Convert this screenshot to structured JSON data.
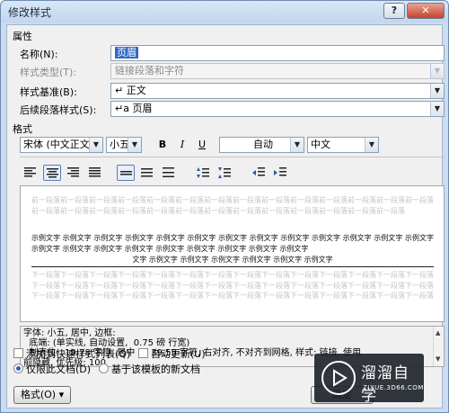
{
  "window": {
    "title": "修改样式",
    "help_label": "?",
    "close_label": "✕"
  },
  "properties": {
    "section_label": "属性",
    "name": {
      "label": "名称(N):",
      "value": "页眉"
    },
    "style_type": {
      "label": "样式类型(T):",
      "value": "链接段落和字符"
    },
    "based_on": {
      "label": "样式基准(B):",
      "value": "↵ 正文"
    },
    "next_style": {
      "label": "后续段落样式(S):",
      "value": "↵a 页眉"
    }
  },
  "format": {
    "section_label": "格式",
    "font": "宋体 (中文正文)",
    "size": "小五",
    "bold": "B",
    "italic": "I",
    "underline": "U",
    "color": "自动",
    "script": "中文"
  },
  "preview": {
    "previous_para": "前一段落前一段落前一段落前一段落前一段落前一段落前一段落前一段落前一段落前一段落前一段落前一段落前一段落前一段落前一段落前一段落前一段落前一段落前一段落前一段落前一段落前一段落前一段落前一段落前一段落前一段落前一段落",
    "sample": "示例文字 示例文字 示例文字 示例文字 示例文字 示例文字 示例文字 示例文字 示例文字 示例文字 示例文字 示例文字 示例文字 示例文字 示例文字 示例文字 示例文字 示例文字 示例文字 示例文字 示例文字 示例文字",
    "sample_last": "文字 示例文字 示例文字 示例文字 示例文字 示例文字 示例文字",
    "next_para": "下一段落下一段落下一段落下一段落下一段落下一段落下一段落下一段落下一段落下一段落下一段落下一段落下一段落下一段落下一段落下一段落下一段落下一段落下一段落下一段落下一段落下一段落下一段落下一段落下一段落下一段落下一段落下一段落下一段落下一段落下一段落下一段落下一段落下一段落下一段落下一段落下一段落下一段落下一段落下一段落下一段落下一段落"
  },
  "description": {
    "line1": "字体: 小五, 居中, 边框:",
    "line2": "  底端: (单实线, 自动设置,  0.75 磅 行宽)",
    "line3": "  制表位:  19.78 字符, 居中 +  39.55 字符, 右对齐, 不对齐到网格, 样式: 链接, 使用",
    "line4": "前隐藏, 优先级: 100"
  },
  "options": {
    "add_to_quick": "添加到快速样式列表(Q)",
    "auto_update": "自动更新(U)",
    "this_doc_only": "仅限此文档(D)",
    "new_docs": "基于该模板的新文档"
  },
  "buttons": {
    "format": "格式(O) ▾",
    "ok": "确定"
  },
  "watermark": {
    "name": "溜溜自学",
    "url": "ZIXUE.3D66.COM"
  }
}
